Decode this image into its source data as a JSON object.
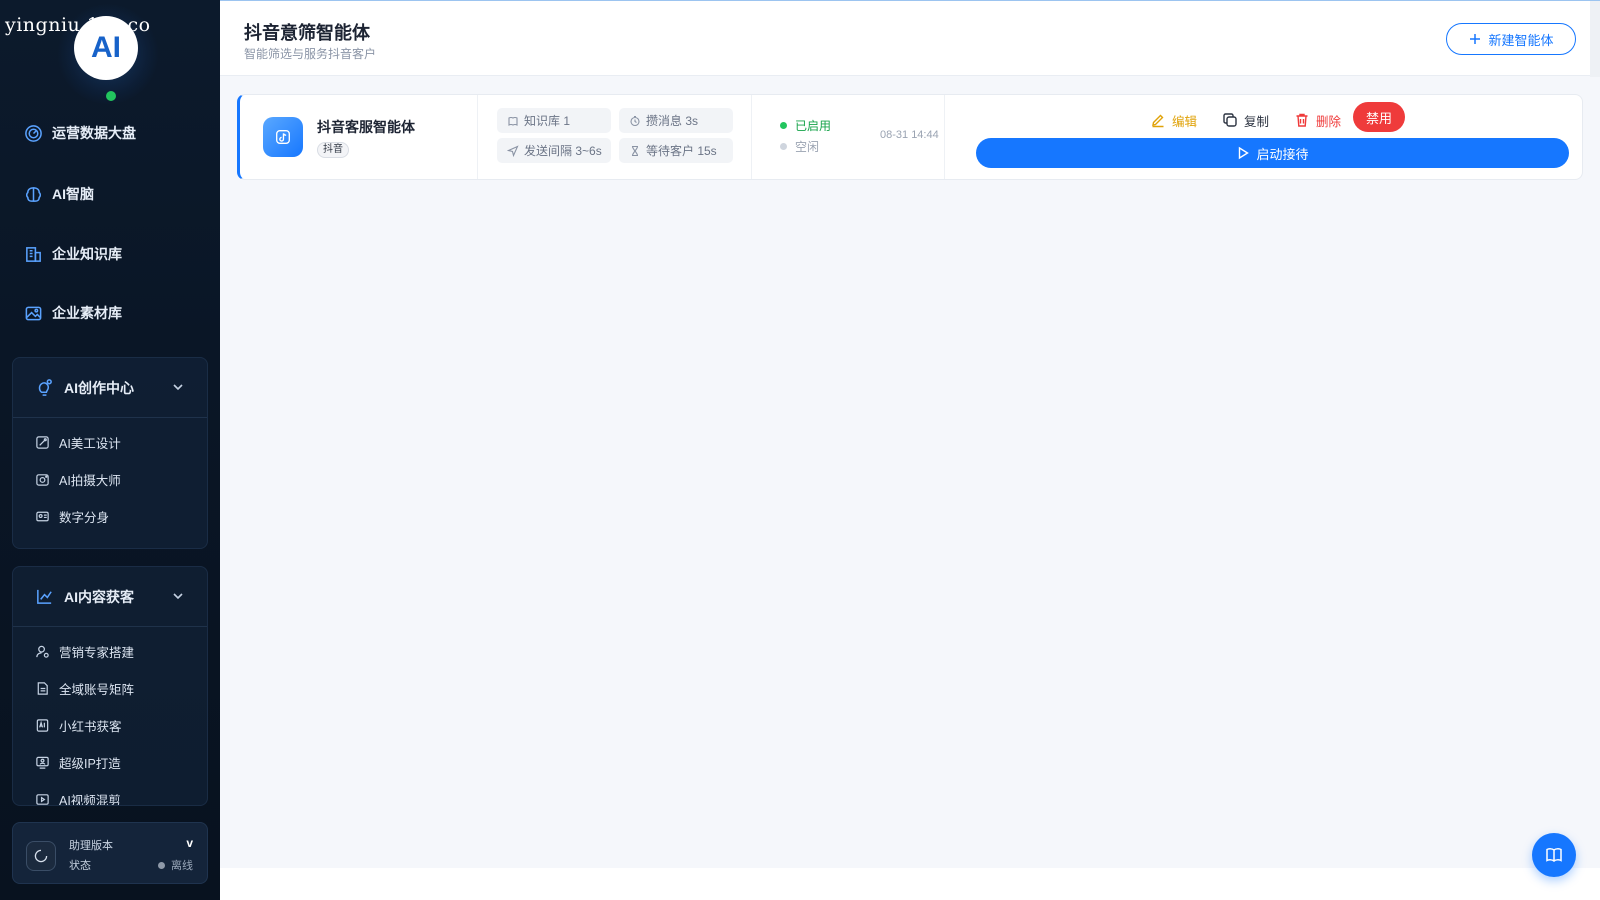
{
  "watermark": "yingniu.10v.co",
  "logo": {
    "text": "AI"
  },
  "sidebar": {
    "nav": [
      {
        "label": "运营数据大盘",
        "icon": "dashboard-icon"
      },
      {
        "label": "AI智脑",
        "icon": "brain-icon"
      },
      {
        "label": "企业知识库",
        "icon": "building-icon"
      },
      {
        "label": "企业素材库",
        "icon": "image-icon"
      }
    ],
    "groups": [
      {
        "title": "AI创作中心",
        "icon": "lightbulb-gear-icon",
        "items": [
          {
            "label": "AI美工设计",
            "icon": "design-icon"
          },
          {
            "label": "AI拍摄大师",
            "icon": "camera-icon"
          },
          {
            "label": "数字分身",
            "icon": "id-card-icon"
          }
        ]
      },
      {
        "title": "AI内容获客",
        "icon": "trend-chart-icon",
        "items": [
          {
            "label": "营销专家搭建",
            "icon": "user-gear-icon"
          },
          {
            "label": "全域账号矩阵",
            "icon": "document-icon"
          },
          {
            "label": "小红书获客",
            "icon": "ai-badge-icon"
          },
          {
            "label": "超级IP打造",
            "icon": "monitor-user-icon"
          },
          {
            "label": "AI视频混剪",
            "icon": "video-icon"
          }
        ]
      }
    ],
    "assistant": {
      "version_label": "助理版本",
      "version_value": "v",
      "status_label": "状态",
      "status_value": "离线"
    }
  },
  "header": {
    "title": "抖音意筛智能体",
    "subtitle": "智能筛选与服务抖音客户",
    "new_button": "新建智能体"
  },
  "agent": {
    "name": "抖音客服智能体",
    "platform_tag": "抖音",
    "stats": [
      {
        "label": "知识库 1",
        "icon": "book-icon"
      },
      {
        "label": "攒消息 3s",
        "icon": "timer-icon"
      },
      {
        "label": "发送间隔 3~6s",
        "icon": "send-icon"
      },
      {
        "label": "等待客户 15s",
        "icon": "hourglass-icon"
      }
    ],
    "status_enabled": "已启用",
    "status_idle": "空闲",
    "time": "08-31 14:44",
    "actions": {
      "edit": "编辑",
      "copy": "复制",
      "delete": "删除",
      "disable": "禁用",
      "start": "启动接待"
    }
  },
  "colors": {
    "primary": "#1677ff",
    "danger": "#ef3b3b",
    "warning": "#e0a208",
    "success": "#22c55e",
    "sidebar_bg": "#0a1626"
  }
}
